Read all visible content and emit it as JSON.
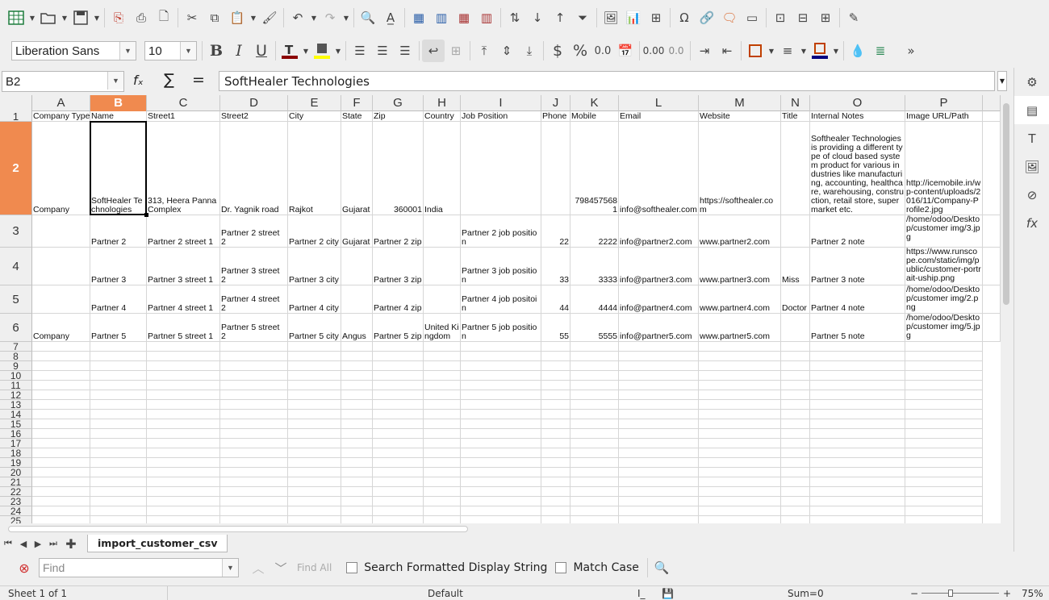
{
  "toolbar1": {
    "icons": [
      "spreadsheet-new-icon",
      "open-folder-icon",
      "save-icon",
      "export-pdf-icon",
      "print-icon",
      "print-preview-icon",
      "cut-icon",
      "copy-icon",
      "paste-icon",
      "clone-formatting-icon",
      "undo-icon",
      "redo-icon",
      "find-replace-icon",
      "spelling-icon",
      "row-icon",
      "column-icon",
      "delete-row-icon",
      "delete-column-icon",
      "sort-icon",
      "sort-ascending-icon",
      "sort-descending-icon",
      "autofilter-icon",
      "image-icon",
      "chart-icon",
      "pivot-table-icon",
      "special-character-icon",
      "hyperlink-icon",
      "comment-icon",
      "header-footer-icon",
      "define-print-area-icon",
      "freeze-icon",
      "split-window-icon",
      "show-draw-functions-icon"
    ]
  },
  "toolbar2": {
    "font_name": "Liberation Sans",
    "font_size": "10",
    "bold": "B",
    "italic": "I",
    "underline": "U",
    "currency": "$",
    "percent": "%",
    "number_format": "0.0",
    "add_decimal": "0.00",
    "delete_decimal": "0.0",
    "font_color": "#8b0000",
    "highlight_color": "#ffff00",
    "border_color": "#c04000",
    "background_color": "#000080"
  },
  "formula_bar": {
    "name_box": "B2",
    "func_wizard": "fₓ",
    "sum": "∑",
    "equals": "=",
    "content": "SoftHealer Technologies"
  },
  "columns": [
    "A",
    "B",
    "C",
    "D",
    "E",
    "F",
    "G",
    "H",
    "I",
    "J",
    "K",
    "L",
    "M",
    "N",
    "O",
    "P"
  ],
  "selected_column": "B",
  "selected_row": "2",
  "rows": [
    {
      "num": "1",
      "cells": [
        "Company Type",
        "Name",
        "Street1",
        "Street2",
        "City",
        "State",
        "Zip",
        "Country",
        "Job Position",
        "Phone",
        "Mobile",
        "Email",
        "Website",
        "Title",
        "Internal Notes",
        "Image URL/Path"
      ]
    },
    {
      "num": "2",
      "cells": [
        "Company",
        "SoftHealer Technologies",
        "313, Heera Panna Complex",
        "Dr. Yagnik road",
        "Rajkot",
        "Gujarat",
        "360001",
        "India",
        "",
        "",
        "7984575681",
        "info@softhealer.com",
        "https://softhealer.com",
        "",
        "Softhealer Technologies is providing a different type of cloud based system product for various industries like manufacturing, accounting, healthcare, warehousing, construction, retail store, super market etc.",
        "http://icemobile.in/wp-content/uploads/2016/11/Company-Profile2.jpg"
      ]
    },
    {
      "num": "3",
      "cells": [
        "",
        "Partner 2",
        "Partner 2 street 1",
        "Partner 2 street 2",
        "Partner 2 city",
        "Gujarat",
        "Partner 2 zip",
        "",
        "Partner 2 job position",
        "22",
        "2222",
        "info@partner2.com",
        "www.partner2.com",
        "",
        "Partner 2 note",
        "/home/odoo/Desktop/customer img/3.jpg"
      ]
    },
    {
      "num": "4",
      "cells": [
        "",
        "Partner 3",
        "Partner 3 street 1",
        "Partner 3 street 2",
        "Partner 3 city",
        "",
        "Partner 3 zip",
        "",
        "Partner 3 job position",
        "33",
        "3333",
        "info@partner3.com",
        "www.partner3.com",
        "Miss",
        "Partner 3 note",
        "https://www.runscope.com/static/img/public/customer-portrait-uship.png"
      ]
    },
    {
      "num": "5",
      "cells": [
        "",
        "Partner 4",
        "Partner 4 street 1",
        "Partner 4 street 2",
        "Partner 4 city",
        "",
        "Partner 4 zip",
        "",
        "Partner 4 job positoin",
        "44",
        "4444",
        "info@partner4.com",
        "www.partner4.com",
        "Doctor",
        "Partner 4 note",
        "/home/odoo/Desktop/customer img/2.png"
      ]
    },
    {
      "num": "6",
      "cells": [
        "Company",
        "Partner 5",
        "Partner 5 street 1",
        "Partner 5 street 2",
        "Partner 5 city",
        "Angus",
        "Partner 5 zip",
        "United Kingdom",
        "Partner 5 job position",
        "55",
        "5555",
        "info@partner5.com",
        "www.partner5.com",
        "",
        "Partner 5 note",
        "/home/odoo/Desktop/customer img/5.jpg"
      ]
    }
  ],
  "empty_rows": [
    "7",
    "8",
    "9",
    "10",
    "11",
    "12",
    "13",
    "14",
    "15",
    "16",
    "17",
    "18",
    "19",
    "20",
    "21",
    "22",
    "23",
    "24",
    "25"
  ],
  "sheet_tabs": {
    "active": "import_customer_csv"
  },
  "find_bar": {
    "placeholder": "Find",
    "find_all": "Find All",
    "search_formatted": "Search Formatted Display String",
    "match_case": "Match Case"
  },
  "status_bar": {
    "sheet": "Sheet 1 of 1",
    "page_style": "Default",
    "sum": "Sum=0",
    "zoom": "75%",
    "zoom_level": 0.75
  }
}
